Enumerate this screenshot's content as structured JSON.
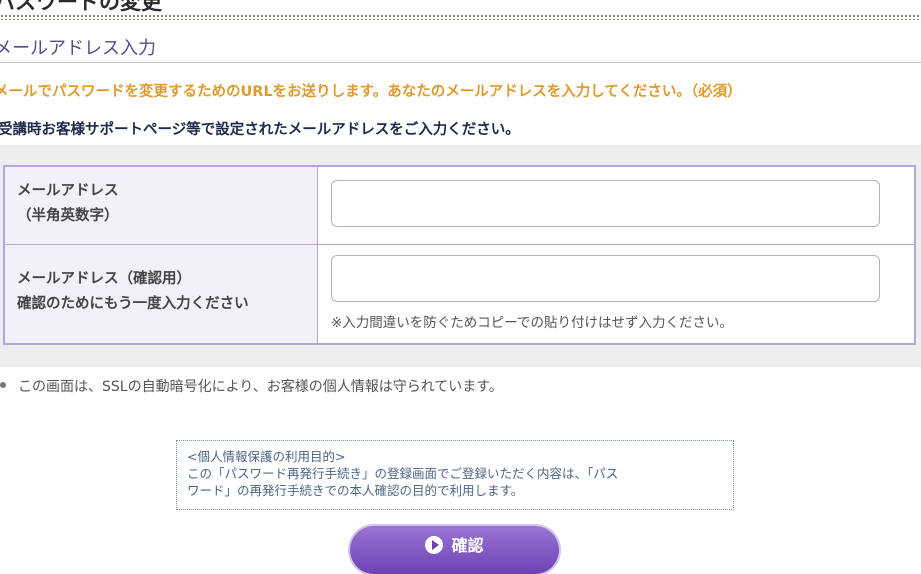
{
  "page": {
    "heading": "パスワードの変更"
  },
  "section": {
    "title": "メールアドレス入力",
    "lead_orange": "メールでパスワードを変更するためのURLをお送りします。あなたのメールアドレスを入力してください。（必須）",
    "lead_navy": "受講時お客様サポートページ等で設定されたメールアドレスをご入力ください。"
  },
  "form": {
    "email": {
      "label_line1": "メールアドレス",
      "label_line2": "（半角英数字）",
      "value": ""
    },
    "email_confirm": {
      "label_line1": "メールアドレス（確認用）",
      "label_line2": "確認のためにもう一度入力ください",
      "value": "",
      "note": "※入力間違いを防ぐためコピーでの貼り付けはせず入力ください。"
    }
  },
  "ssl_note": "この画面は、SSLの自動暗号化により、お客様の個人情報は守られています。",
  "privacy": {
    "title": "<個人情報保護の利用目的>",
    "line1": "この「パスワード再発行手続き」の登録画面でご登録いただく内容は、「パス",
    "line2": "ワード」の再発行手続きでの本人確認の目的で利用します。"
  },
  "confirm_button": {
    "label": "確認",
    "icon": "play-circle-icon"
  },
  "colors": {
    "accent": "#6d43b4",
    "heading_orange": "#e09a2a",
    "table_border": "#b5a6d9"
  }
}
